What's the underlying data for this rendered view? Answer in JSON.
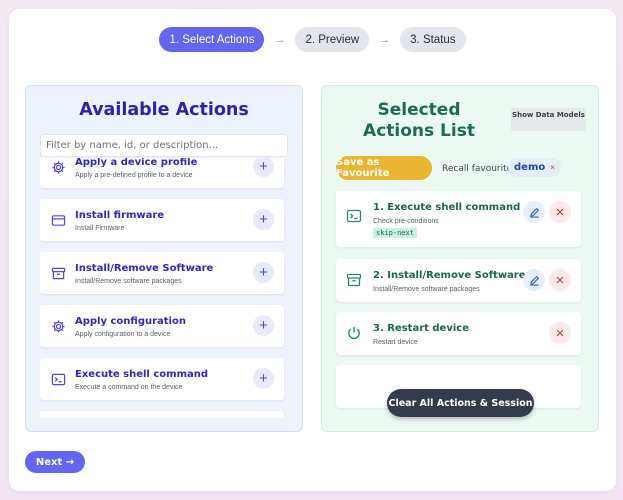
{
  "steps": [
    {
      "label": "1. Select Actions",
      "active": true
    },
    {
      "label": "2. Preview",
      "active": false
    },
    {
      "label": "3. Status",
      "active": false
    }
  ],
  "step_arrow": "→",
  "available": {
    "title": "Available Actions",
    "filter_placeholder": "Filter by name, id, or description...",
    "add_label": "+",
    "items": [
      {
        "title": "Apply a device profile",
        "desc": "Apply a pre-defined profile to a device",
        "icon": "gear-icon"
      },
      {
        "title": "Install firmware",
        "desc": "Install Firmware",
        "icon": "card-icon"
      },
      {
        "title": "Install/Remove Software",
        "desc": "Install/Remove software packages",
        "icon": "archive-icon"
      },
      {
        "title": "Apply configuration",
        "desc": "Apply configuration to a device",
        "icon": "gear-icon"
      },
      {
        "title": "Execute shell command",
        "desc": "Execute a command on the device",
        "icon": "terminal-icon"
      }
    ]
  },
  "selected": {
    "title": "Selected Actions List",
    "show_models_label": "Show Data Models",
    "save_fav_label": "Save as Favourite",
    "recall_label": "Recall favourite:",
    "recall_chip": "demo",
    "recall_chip_remove": "×",
    "delete_label": "✕",
    "items": [
      {
        "title": "1. Execute shell command",
        "desc": "Check pre-conditions",
        "tag": "skip-next",
        "icon": "terminal-icon",
        "editable": true
      },
      {
        "title": "2. Install/Remove Software",
        "desc": "Install/Remove software packages",
        "icon": "archive-icon",
        "editable": true
      },
      {
        "title": "3. Restart device",
        "desc": "Restart device",
        "icon": "power-icon",
        "editable": false
      }
    ],
    "clear_label": "Clear All Actions & Session"
  },
  "next_label": "Next →",
  "colors": {
    "accent": "#6366f1",
    "favourite": "#eab530",
    "clear": "#343b4a"
  }
}
